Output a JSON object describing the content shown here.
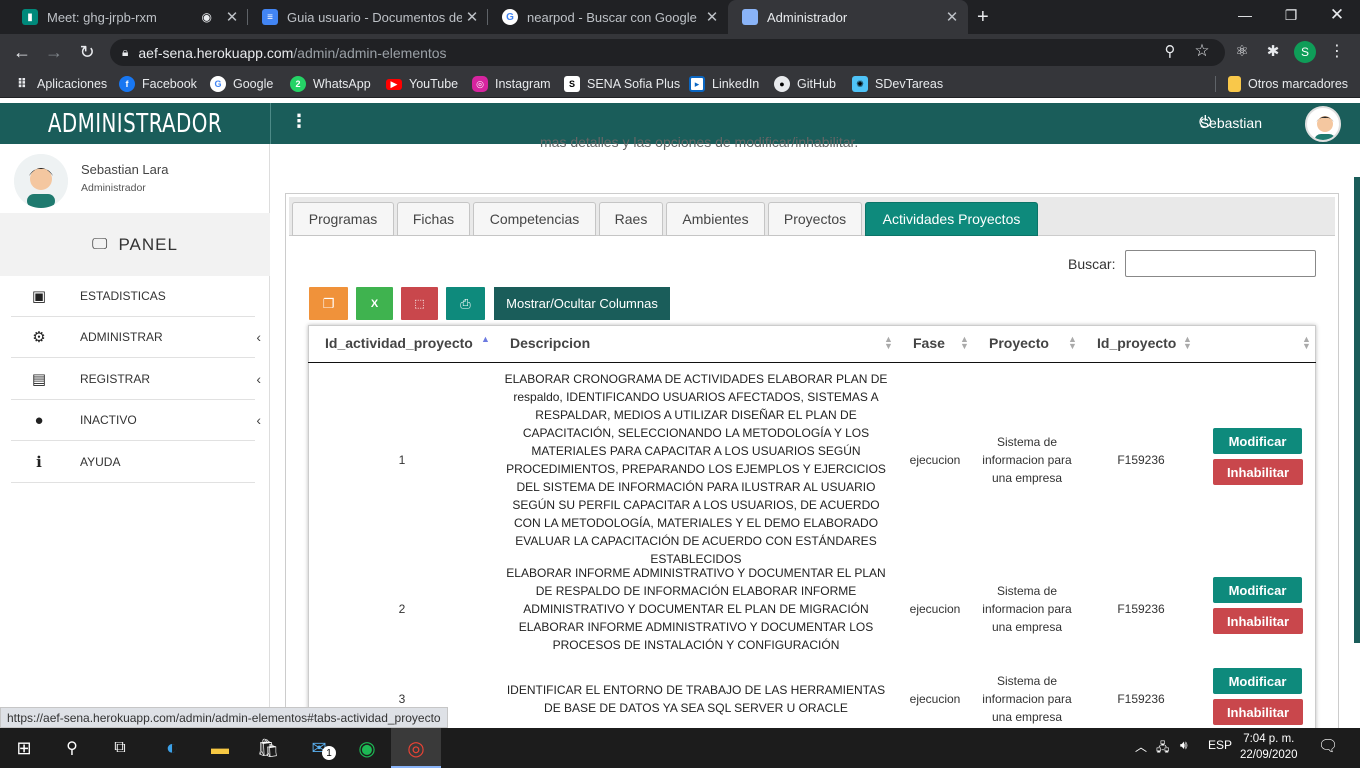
{
  "browser": {
    "tabs": [
      {
        "title": "Meet: ghg-jrpb-rxm",
        "icon": "meet-icon"
      },
      {
        "title": "Guia usuario - Documentos de G",
        "icon": "docs-icon"
      },
      {
        "title": "nearpod - Buscar con Google",
        "icon": "google-icon"
      },
      {
        "title": "Administrador",
        "icon": "page-icon"
      }
    ],
    "url_host": "aef-sena.herokuapp.com",
    "url_path": "/admin/admin-elementos",
    "profile_initial": "S",
    "bookmarks": [
      "Aplicaciones",
      "Facebook",
      "Google",
      "WhatsApp",
      "YouTube",
      "Instagram",
      "SENA Sofia Plus",
      "LinkedIn",
      "GitHub",
      "SDevTareas"
    ],
    "other_bookmarks": "Otros marcadores"
  },
  "header": {
    "brand": "ADMINISTRADOR",
    "user": "Sebastian"
  },
  "sidebar": {
    "user_name": "Sebastian Lara",
    "user_role": "Administrador",
    "panel_label": "PANEL",
    "items": [
      {
        "label": "ESTADISTICAS",
        "icon": "stats-icon"
      },
      {
        "label": "ADMINISTRAR",
        "icon": "users-cog-icon"
      },
      {
        "label": "REGISTRAR",
        "icon": "id-card-icon"
      },
      {
        "label": "INACTIVO",
        "icon": "inactive-icon"
      },
      {
        "label": "AYUDA",
        "icon": "info-icon"
      }
    ]
  },
  "main": {
    "cut_text": "mas detalles y las opciones de modificar/inhabilitar.",
    "tabs": [
      "Programas",
      "Fichas",
      "Competencias",
      "Raes",
      "Ambientes",
      "Proyectos",
      "Actividades Proyectos"
    ],
    "active_tab": "Actividades Proyectos",
    "search_label": "Buscar:",
    "columns_button": "Mostrar/Ocultar Columnas",
    "table": {
      "headers": [
        "Id_actividad_proyecto",
        "Descripcion",
        "Fase",
        "Proyecto",
        "Id_proyecto"
      ],
      "rows": [
        {
          "id": "1",
          "descripcion": "ELABORAR CRONOGRAMA DE ACTIVIDADES ELABORAR PLAN DE respaldo, IDENTIFICANDO USUARIOS AFECTADOS, SISTEMAS A RESPALDAR, MEDIOS A UTILIZAR DISEÑAR EL PLAN DE CAPACITACIÓN, SELECCIONANDO LA METODOLOGÍA Y LOS MATERIALES PARA CAPACITAR A LOS USUARIOS SEGÚN PROCEDIMIENTOS, PREPARANDO LOS EJEMPLOS Y EJERCICIOS DEL SISTEMA DE INFORMACIÓN PARA ILUSTRAR AL USUARIO SEGÚN SU PERFIL CAPACITAR A LOS USUARIOS, DE ACUERDO CON LA METODOLOGÍA, MATERIALES Y EL DEMO ELABORADO EVALUAR LA CAPACITACIÓN DE ACUERDO CON ESTÁNDARES ESTABLECIDOS",
          "fase": "ejecucion",
          "proyecto": "Sistema de informacion para una empresa",
          "id_proyecto": "F159236"
        },
        {
          "id": "2",
          "descripcion": "ELABORAR INFORME ADMINISTRATIVO Y DOCUMENTAR EL PLAN DE RESPALDO DE INFORMACIÓN ELABORAR INFORME ADMINISTRATIVO Y DOCUMENTAR EL PLAN DE MIGRACIÓN ELABORAR INFORME ADMINISTRATIVO Y DOCUMENTAR LOS PROCESOS DE INSTALACIÓN Y CONFIGURACIÓN",
          "fase": "ejecucion",
          "proyecto": "Sistema de informacion para una empresa",
          "id_proyecto": "F159236"
        },
        {
          "id": "3",
          "descripcion": "IDENTIFICAR EL ENTORNO DE TRABAJO DE LAS HERRAMIENTAS DE BASE DE DATOS YA SEA SQL SERVER U ORACLE",
          "fase": "ejecucion",
          "proyecto": "Sistema de informacion para una empresa",
          "id_proyecto": "F159236"
        }
      ],
      "modify_label": "Modificar",
      "disable_label": "Inhabilitar"
    }
  },
  "status_url": "https://aef-sena.herokuapp.com/admin/admin-elementos#tabs-actividad_proyecto",
  "taskbar": {
    "lang": "ESP",
    "time": "7:04 p. m.",
    "date": "22/09/2020",
    "mail_badge": "1"
  }
}
